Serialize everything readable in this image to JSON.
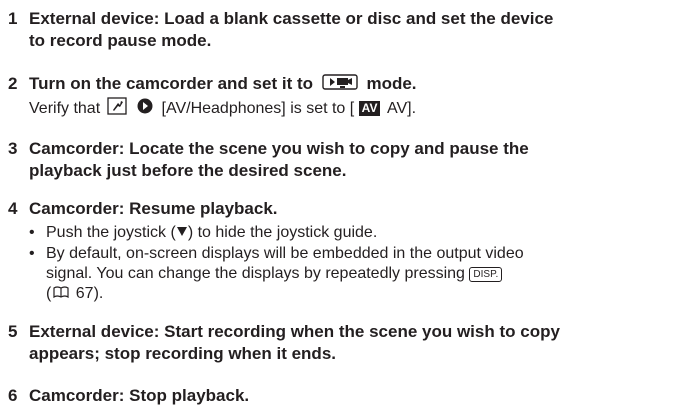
{
  "steps": [
    {
      "num": "1",
      "heading_line1": "External device: Load a blank cassette or disc and set the device",
      "heading_line2": "to record pause mode."
    },
    {
      "num": "2",
      "heading_pre": "Turn on the camcorder and set it to",
      "heading_post": "mode.",
      "sub_pre": "Verify that",
      "sub_mid": "[AV/Headphones] is set to [",
      "sub_av_badge": "AV",
      "sub_post": "AV]."
    },
    {
      "num": "3",
      "heading_line1": "Camcorder: Locate the scene you wish to copy and pause the",
      "heading_line2": "playback just before the desired scene."
    },
    {
      "num": "4",
      "heading_line1": "Camcorder: Resume playback.",
      "bullet1_pre": "Push the joystick (",
      "bullet1_post": ") to hide the joystick guide.",
      "bullet2_line1": "By default, on-screen displays will be embedded in the output video",
      "bullet2_line2_pre": "signal. You can change the displays by repeatedly pressing",
      "bullet2_button": "DISP.",
      "bullet2_line3": "67)."
    },
    {
      "num": "5",
      "heading_line1": "External device: Start recording when the scene you wish to copy",
      "heading_line2": "appears; stop recording when it ends."
    },
    {
      "num": "6",
      "heading_line1": "Camcorder: Stop playback."
    }
  ],
  "bullet_char": "•",
  "icons": [
    "playback-mode-icon",
    "menu-setup-icon",
    "arrow-right-icon",
    "down-triangle-icon",
    "book-reference-icon"
  ]
}
